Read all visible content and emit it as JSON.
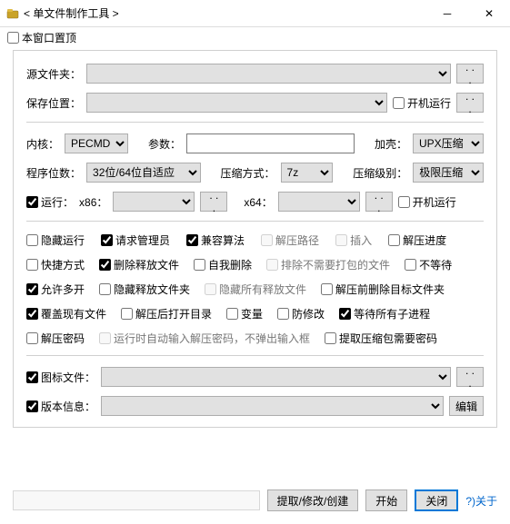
{
  "window": {
    "title": "< 单文件制作工具 >",
    "min_tooltip": "最小化",
    "close_tooltip": "关闭"
  },
  "topbar": {
    "topmost_label": "本窗口置顶",
    "topmost_checked": false
  },
  "src": {
    "label": "源文件夹：",
    "browse": ". . ."
  },
  "save": {
    "label": "保存位置：",
    "startup_label": "开机运行",
    "browse": ". . ."
  },
  "kernel": {
    "label": "内核：",
    "value": "PECMD",
    "param_label": "参数：",
    "param_value": "",
    "shell_label": "加壳：",
    "shell_value": "UPX压缩"
  },
  "prog": {
    "bits_label": "程序位数：",
    "bits_value": "32位/64位自适应",
    "compress_label": "压缩方式：",
    "compress_value": "7z",
    "level_label": "压缩级别：",
    "level_value": "极限压缩"
  },
  "run": {
    "label": "运行：",
    "checked": true,
    "x86_label": "x86：",
    "x86_browse": ". . .",
    "x64_label": "x64：",
    "x64_browse": ". . .",
    "startup_label": "开机运行"
  },
  "opts": {
    "hide_run": {
      "label": "隐藏运行",
      "checked": false
    },
    "req_admin": {
      "label": "请求管理员",
      "checked": true
    },
    "compat": {
      "label": "兼容算法",
      "checked": true
    },
    "extract_path": {
      "label": "解压路径",
      "checked": false,
      "disabled": true
    },
    "insert": {
      "label": "插入",
      "checked": false,
      "disabled": true
    },
    "progress": {
      "label": "解压进度",
      "checked": false
    },
    "shortcut": {
      "label": "快捷方式",
      "checked": false
    },
    "del_release": {
      "label": "删除释放文件",
      "checked": true
    },
    "self_del": {
      "label": "自我删除",
      "checked": false
    },
    "exclude": {
      "label": "排除不需要打包的文件",
      "checked": false,
      "disabled": true
    },
    "nowait": {
      "label": "不等待",
      "checked": false
    },
    "allow_multi": {
      "label": "允许多开",
      "checked": true
    },
    "hide_folder": {
      "label": "隐藏释放文件夹",
      "checked": false
    },
    "hide_all": {
      "label": "隐藏所有释放文件",
      "checked": false,
      "disabled": true
    },
    "predel": {
      "label": "解压前删除目标文件夹",
      "checked": false
    },
    "overwrite": {
      "label": "覆盖现有文件",
      "checked": true
    },
    "opendir": {
      "label": "解压后打开目录",
      "checked": false
    },
    "vars": {
      "label": "变量",
      "checked": false
    },
    "antimod": {
      "label": "防修改",
      "checked": false
    },
    "waitchild": {
      "label": "等待所有子进程",
      "checked": true
    },
    "pwd": {
      "label": "解压密码",
      "checked": false
    },
    "autopwd": {
      "label": "运行时自动输入解压密码，不弹出输入框",
      "checked": false,
      "disabled": true
    },
    "extractpwd": {
      "label": "提取压缩包需要密码",
      "checked": false
    }
  },
  "icon": {
    "label": "图标文件：",
    "checked": true,
    "browse": ". . ."
  },
  "version": {
    "label": "版本信息：",
    "checked": true,
    "edit_btn": "编辑"
  },
  "bottom": {
    "extract": "提取/修改/创建",
    "start": "开始",
    "close": "关闭",
    "about": "?)关于"
  }
}
